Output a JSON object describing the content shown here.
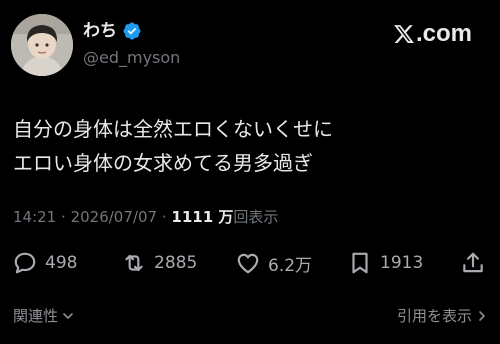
{
  "header": {
    "display_name": "わち",
    "handle": "@ed_myson",
    "brand": ".com",
    "verified_color": "#1d9bf0"
  },
  "tweet": {
    "lines": [
      "自分の身体は全然エロくないくせに",
      "エロい身体の女求めてる男多過ぎ"
    ]
  },
  "meta": {
    "time": "14:21",
    "date": "2026/07/07",
    "separator": "·",
    "views_count": "1111 万",
    "views_label": "回表示"
  },
  "actions": {
    "replies": "498",
    "reposts": "2885",
    "likes": "6.2万",
    "bookmarks": "1913"
  },
  "footer": {
    "related_label": "関連性",
    "quotes_label": "引用を表示"
  },
  "icons": {
    "reply": "reply-icon",
    "repost": "repost-icon",
    "like": "heart-icon",
    "bookmark": "bookmark-icon",
    "share": "share-icon"
  }
}
